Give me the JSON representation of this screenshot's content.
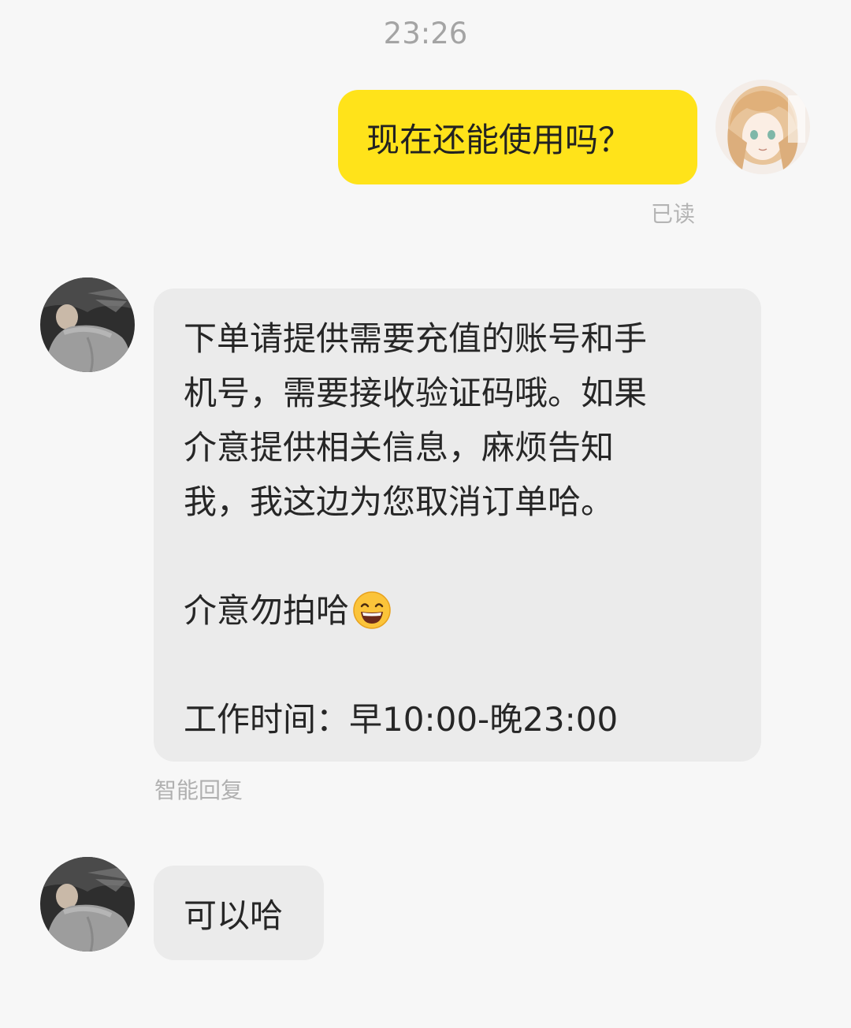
{
  "chat": {
    "timestamp": "23:26",
    "outgoing": {
      "text": "现在还能使用吗？",
      "status": "已读"
    },
    "incoming_auto": {
      "lines": [
        "下单请提供需要充值的账号和手",
        "机号，需要接收验证码哦。如果",
        "介意提供相关信息，麻烦告知",
        "我，我这边为您取消订单哈。"
      ],
      "line2": "介意勿拍哈",
      "emoji": "grinning-face-emoji",
      "line3": "工作时间：早10:00-晚23:00",
      "label": "智能回复"
    },
    "incoming_reply": {
      "text": "可以哈"
    }
  },
  "colors": {
    "background": "#f7f7f7",
    "outgoing_bubble": "#ffe31a",
    "incoming_bubble": "#ebebeb",
    "meta_text": "#b0b0b0"
  }
}
